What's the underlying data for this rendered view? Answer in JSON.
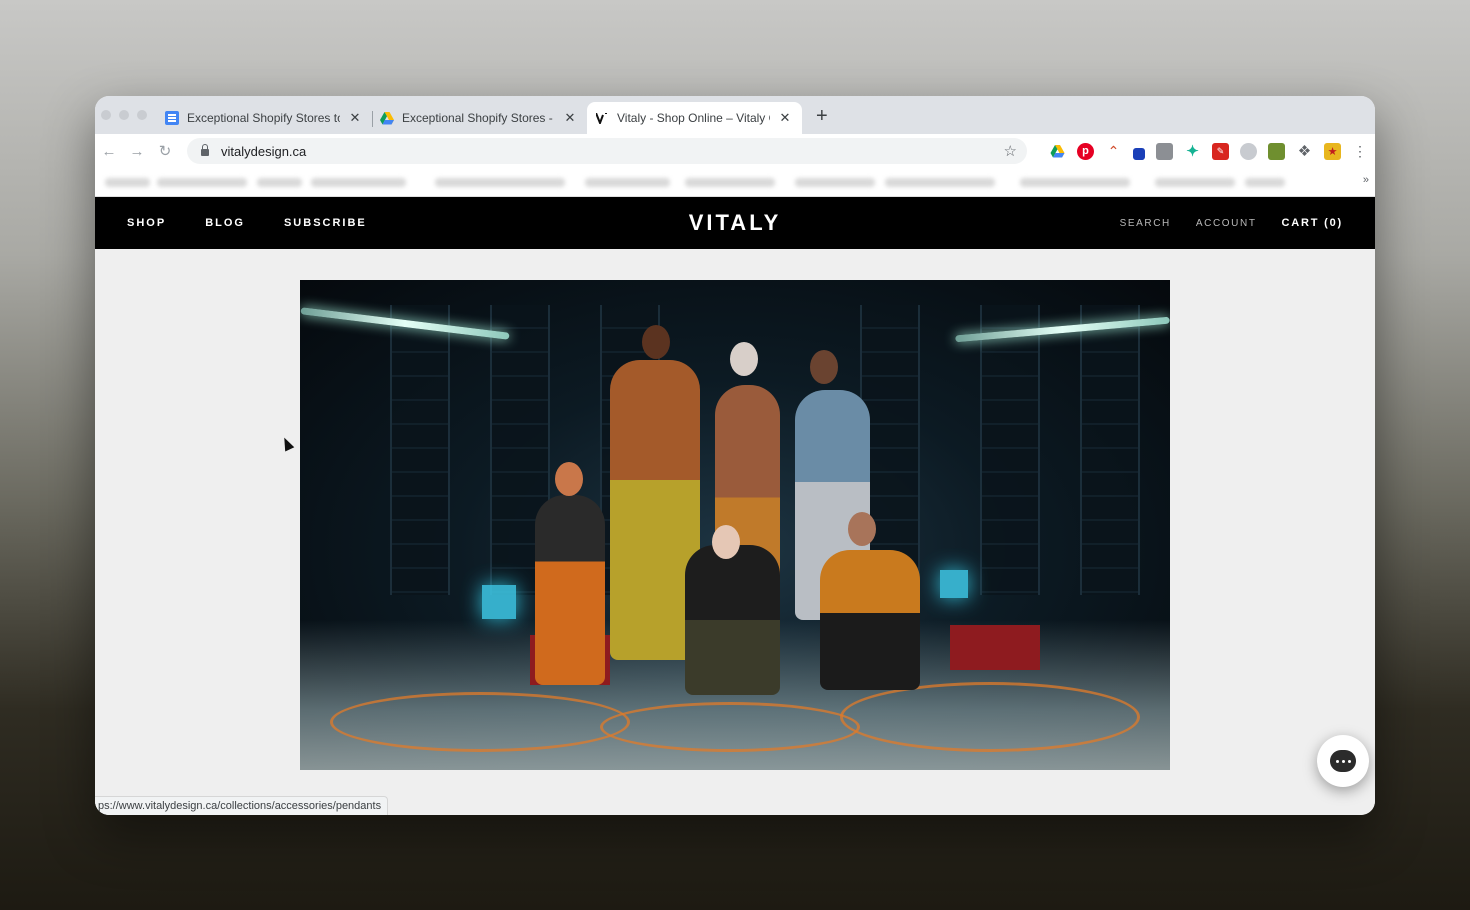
{
  "browser": {
    "tabs": [
      {
        "title": "Exceptional Shopify Stores to I",
        "favicon": "google-docs-icon",
        "active": false
      },
      {
        "title": "Exceptional Shopify Stores - G",
        "favicon": "google-drive-icon",
        "active": false
      },
      {
        "title": "Vitaly - Shop Online – Vitaly C",
        "favicon": "vitaly-icon",
        "active": true
      }
    ],
    "tab_close_glyph": "✕",
    "new_tab_glyph": "+",
    "address": "vitalydesign.ca",
    "status_url": "ps://www.vitalydesign.ca/collections/accessories/pendants",
    "bookmarks_overflow": "»",
    "extensions": [
      "google-drive-icon",
      "pinterest-icon",
      "arc-icon",
      "eyedropper-icon",
      "tab-icon",
      "leaf-icon",
      "pdf-icon",
      "moon-icon",
      "grammar-icon",
      "puzzle-icon",
      "star-badge-icon"
    ]
  },
  "site": {
    "logo": "VITALY",
    "nav_left": [
      "SHOP",
      "BLOG",
      "SUBSCRIBE"
    ],
    "nav_right": {
      "search": "SEARCH",
      "account": "ACCOUNT",
      "cart": "CART (0)"
    }
  },
  "colors": {
    "header_bg": "#000000",
    "page_bg": "#efefef",
    "tab_strip": "#dee1e6"
  }
}
